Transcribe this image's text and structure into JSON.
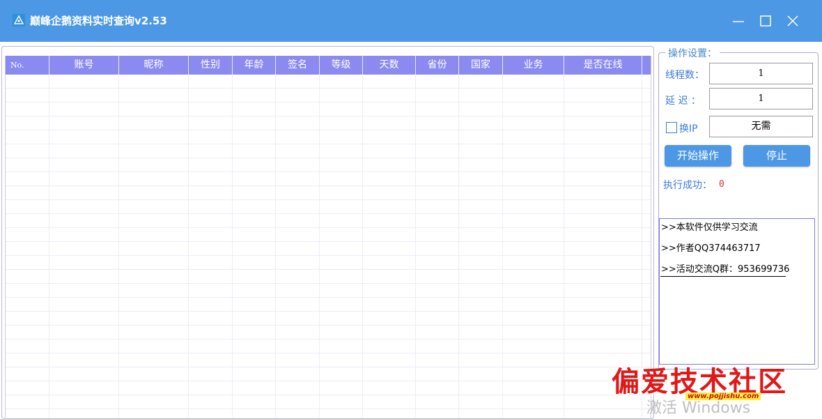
{
  "window": {
    "title": "巅峰企鹅资料实时查询v2.53",
    "colors": {
      "titlebar": "#4d98e5",
      "header": "#8a8af0",
      "accent": "#3a7bd5",
      "count": "#e53030"
    }
  },
  "table": {
    "columns": [
      "No.",
      "账号",
      "昵称",
      "性别",
      "年龄",
      "签名",
      "等级",
      "天数",
      "省份",
      "国家",
      "业务",
      "是否在线"
    ],
    "rows": []
  },
  "settings": {
    "legend": "操作设置：",
    "threads_label": "线程数：",
    "threads_value": "1",
    "delay_label": "延 迟 ：",
    "delay_value": "1",
    "change_ip_label": "换IP",
    "change_ip_checked": false,
    "ip_value": "无需",
    "start_button": "开始操作",
    "stop_button": "停止",
    "success_label": "执行成功：",
    "success_count": "0"
  },
  "log": {
    "lines": [
      ">>本软件仅供学习交流",
      ">>作者QQ374463717",
      ">>活动交流Q群：953699736"
    ]
  },
  "overlay": {
    "watermark_text": "偏爱技术社区",
    "watermark_url": "www.pojjishu.com",
    "activate_text": "激活 Windows"
  }
}
